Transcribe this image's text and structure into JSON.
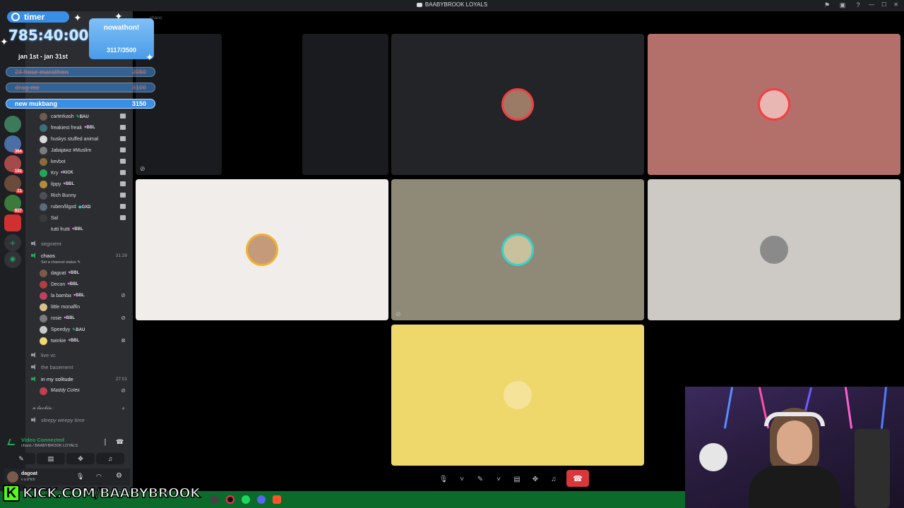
{
  "window": {
    "title": "BAABYBROOK LOYALS",
    "top_mini_label": "chaos"
  },
  "colors": {
    "discord_bg": "#2b2d31",
    "rail_bg": "#1e1f22",
    "connected_green": "#23a55a",
    "hangup_red": "#da373c",
    "overlay_blue": "#3a8ee6",
    "kick_green": "#53fc18"
  },
  "sidebar": {
    "members_top": [
      {
        "name": "carterkash",
        "tag": "BAU",
        "tag_icon": "leaf",
        "avatar_color": "#6c5b4e",
        "stream": true
      },
      {
        "name": "freakiest freak",
        "tag": "BBL",
        "tag_icon": "heart",
        "avatar_color": "#3d6f78",
        "stream": true
      },
      {
        "name": "huskys stuffed animal",
        "tag": "",
        "avatar_color": "#d9d9d9",
        "stream": true
      },
      {
        "name": "Jabajawz #Muslim",
        "tag": "",
        "avatar_color": "#7b7b7b",
        "stream": true
      },
      {
        "name": "kevbot",
        "tag": "",
        "avatar_color": "#8b6b3d",
        "stream": true
      },
      {
        "name": "Kry",
        "tag": "KICK",
        "tag_icon": "heart",
        "avatar_color": "#23a55a",
        "stream": true
      },
      {
        "name": "lippy",
        "tag": "BBL",
        "tag_icon": "heart",
        "avatar_color": "#b38b3c",
        "stream": true
      },
      {
        "name": "Rich Bunny",
        "tag": "",
        "avatar_color": "#4e5058",
        "stream": true
      },
      {
        "name": "ruben/lilgxd",
        "tag": "GXD",
        "tag_icon": "gem",
        "avatar_color": "#5a6b7a",
        "stream": true
      },
      {
        "name": "Sal",
        "tag": "",
        "avatar_color": "#3a3a3a",
        "stream": true
      },
      {
        "name": "tutti frutti",
        "tag": "BBL",
        "tag_icon": "heart",
        "avatar_color": "#2b2d31",
        "stream": false
      }
    ],
    "channels": [
      {
        "name": "segment",
        "active": false
      },
      {
        "name": "chaos",
        "active": true,
        "duration": "31:28",
        "status": "Set a channel status"
      }
    ],
    "chaos_members": [
      {
        "name": "dagoat",
        "tag": "BBL",
        "tag_icon": "heart",
        "avatar_color": "#7a5a4a",
        "icon": ""
      },
      {
        "name": "Decon",
        "tag": "BBL",
        "tag_icon": "heart",
        "avatar_color": "#b04040",
        "icon": ""
      },
      {
        "name": "la bamba",
        "tag": "BBL",
        "tag_icon": "heart",
        "avatar_color": "#c04060",
        "icon": "mute-stream"
      },
      {
        "name": "little monaffin",
        "tag": "",
        "avatar_color": "#d9c28a",
        "icon": ""
      },
      {
        "name": "rosie",
        "tag": "BBL",
        "tag_icon": "heart",
        "avatar_color": "#7a7a7a",
        "icon": "mute"
      },
      {
        "name": "Speedyy",
        "tag": "BAU",
        "tag_icon": "leaf",
        "avatar_color": "#c9c9c9",
        "icon": ""
      },
      {
        "name": "twinkie",
        "tag": "BBL",
        "tag_icon": "heart",
        "avatar_color": "#f0d770",
        "icon": "xbox"
      }
    ],
    "channels_after": [
      {
        "name": "live vc",
        "active": false
      },
      {
        "name": "the basement",
        "active": false
      },
      {
        "name": "in my solitude",
        "active": true,
        "duration": "27:01"
      }
    ],
    "solitude_member": {
      "name": "𝑀𝑎𝑑𝑑𝑦 𝐶𝑜𝑙𝑒𝑠",
      "avatar_color": "#c04050"
    },
    "category": "𝓾 𝓵𝓪𝓬𝓴𝓲𝓷 ·",
    "channel_last": "sleepy weepy time"
  },
  "voice_panel": {
    "status": "Video Connected",
    "location": "chaos / BAABYBROOK LOYALS"
  },
  "user_panel": {
    "username": "dagoat",
    "status": "v u b*tch"
  },
  "overlay": {
    "timer_label": "timer",
    "timer_value": "785:40:00",
    "dates": "jan 1st - jan 31st",
    "goal_title": "nowathon!",
    "goal_count": "3117/3500",
    "goals": [
      {
        "label": "24 hour marathon",
        "value": "2050",
        "done": true
      },
      {
        "label": "drag me",
        "value": "3100",
        "done": true
      },
      {
        "label": "new mukbang",
        "value": "3150",
        "done": false
      }
    ],
    "kick_letter": "K",
    "kick_url": "KICK.COM/BAABYBROOK"
  },
  "call_tiles": [
    {
      "id": "tile-1",
      "bg": "#232428",
      "avatar_color": "#9b7a66",
      "ring": "#f23f43"
    },
    {
      "id": "tile-2",
      "bg": "#b3706a",
      "avatar_color": "#e8b7b4",
      "ring": "#f23f43"
    },
    {
      "id": "tile-3",
      "bg": "#f0edea",
      "avatar_color": "#c49a7a",
      "ring": "#f0b232"
    },
    {
      "id": "tile-4",
      "bg": "#8f8a77",
      "avatar_color": "#c9c09c",
      "ring": "#3bd1c9"
    },
    {
      "id": "tile-5",
      "bg": "#cdc9c4",
      "avatar_color": "#8a8a8a",
      "ring": ""
    },
    {
      "id": "tile-6",
      "bg": "#eed86c",
      "avatar_color": "#f5e39a",
      "ring": ""
    }
  ]
}
